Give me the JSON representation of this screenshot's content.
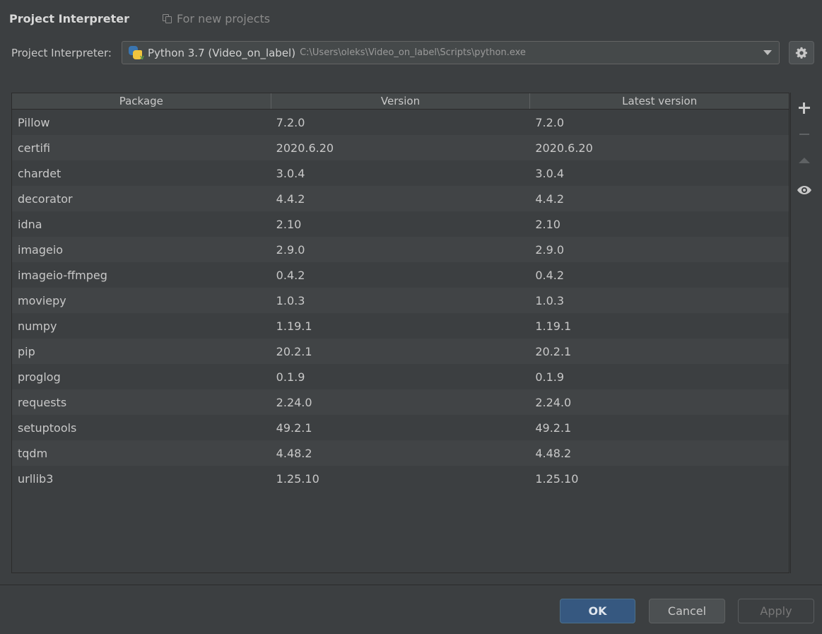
{
  "header": {
    "title": "Project Interpreter",
    "scope_label": "For new projects"
  },
  "interpreter": {
    "label": "Project Interpreter:",
    "name": "Python 3.7 (Video_on_label)",
    "path": "C:\\Users\\oleks\\Video_on_label\\Scripts\\python.exe"
  },
  "table": {
    "columns": [
      "Package",
      "Version",
      "Latest version"
    ],
    "rows": [
      {
        "package": "Pillow",
        "version": "7.2.0",
        "latest": "7.2.0"
      },
      {
        "package": "certifi",
        "version": "2020.6.20",
        "latest": "2020.6.20"
      },
      {
        "package": "chardet",
        "version": "3.0.4",
        "latest": "3.0.4"
      },
      {
        "package": "decorator",
        "version": "4.4.2",
        "latest": "4.4.2"
      },
      {
        "package": "idna",
        "version": "2.10",
        "latest": "2.10"
      },
      {
        "package": "imageio",
        "version": "2.9.0",
        "latest": "2.9.0"
      },
      {
        "package": "imageio-ffmpeg",
        "version": "0.4.2",
        "latest": "0.4.2"
      },
      {
        "package": "moviepy",
        "version": "1.0.3",
        "latest": "1.0.3"
      },
      {
        "package": "numpy",
        "version": "1.19.1",
        "latest": "1.19.1"
      },
      {
        "package": "pip",
        "version": "20.2.1",
        "latest": "20.2.1"
      },
      {
        "package": "proglog",
        "version": "0.1.9",
        "latest": "0.1.9"
      },
      {
        "package": "requests",
        "version": "2.24.0",
        "latest": "2.24.0"
      },
      {
        "package": "setuptools",
        "version": "49.2.1",
        "latest": "49.2.1"
      },
      {
        "package": "tqdm",
        "version": "4.48.2",
        "latest": "4.48.2"
      },
      {
        "package": "urllib3",
        "version": "1.25.10",
        "latest": "1.25.10"
      }
    ]
  },
  "toolbar": {
    "icons": [
      "plus-icon",
      "minus-icon",
      "up-arrow-icon",
      "eye-icon"
    ]
  },
  "footer": {
    "ok_label": "OK",
    "cancel_label": "Cancel",
    "apply_label": "Apply"
  },
  "colors": {
    "background": "#3c3f41",
    "accent_button": "#365880"
  }
}
